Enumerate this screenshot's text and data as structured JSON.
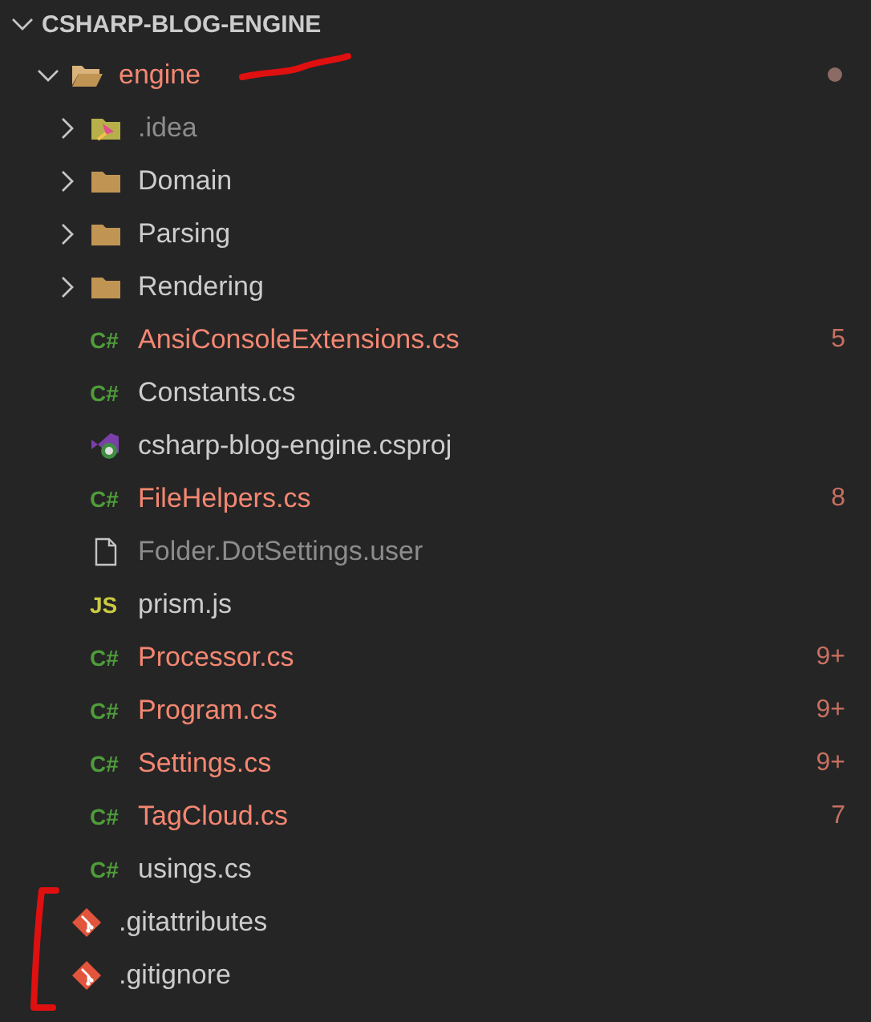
{
  "explorer": {
    "title": "CSHARP-BLOG-ENGINE",
    "expanded": true,
    "items": [
      {
        "name": "engine",
        "kind": "folder",
        "expanded": true,
        "has_errors": true,
        "dimmed": false,
        "dot": true,
        "children": [
          {
            "name": ".idea",
            "kind": "ide",
            "expanded": false,
            "has_errors": false,
            "dimmed": true
          },
          {
            "name": "Domain",
            "kind": "folder",
            "expanded": false,
            "has_errors": false,
            "dimmed": false
          },
          {
            "name": "Parsing",
            "kind": "folder",
            "expanded": false,
            "has_errors": false,
            "dimmed": false
          },
          {
            "name": "Rendering",
            "kind": "folder",
            "expanded": false,
            "has_errors": false,
            "dimmed": false
          },
          {
            "name": "AnsiConsoleExtensions.cs",
            "kind": "csharp",
            "icon_text": "C#",
            "has_errors": true,
            "dimmed": false,
            "problems": "5"
          },
          {
            "name": "Constants.cs",
            "kind": "csharp",
            "icon_text": "C#",
            "has_errors": false,
            "dimmed": false
          },
          {
            "name": "csharp-blog-engine.csproj",
            "kind": "project",
            "has_errors": false,
            "dimmed": false
          },
          {
            "name": "FileHelpers.cs",
            "kind": "csharp",
            "icon_text": "C#",
            "has_errors": true,
            "dimmed": false,
            "problems": "8"
          },
          {
            "name": "Folder.DotSettings.user",
            "kind": "plain",
            "has_errors": false,
            "dimmed": true
          },
          {
            "name": "prism.js",
            "kind": "script",
            "icon_text": "JS",
            "has_errors": false,
            "dimmed": false
          },
          {
            "name": "Processor.cs",
            "kind": "csharp",
            "icon_text": "C#",
            "has_errors": true,
            "dimmed": false,
            "problems": "9+"
          },
          {
            "name": "Program.cs",
            "kind": "csharp",
            "icon_text": "C#",
            "has_errors": true,
            "dimmed": false,
            "problems": "9+"
          },
          {
            "name": "Settings.cs",
            "kind": "csharp",
            "icon_text": "C#",
            "has_errors": true,
            "dimmed": false,
            "problems": "9+"
          },
          {
            "name": "TagCloud.cs",
            "kind": "csharp",
            "icon_text": "C#",
            "has_errors": true,
            "dimmed": false,
            "problems": "7"
          },
          {
            "name": "usings.cs",
            "kind": "csharp",
            "icon_text": "C#",
            "has_errors": false,
            "dimmed": false
          }
        ]
      },
      {
        "name": ".gitattributes",
        "kind": "git",
        "has_errors": false,
        "dimmed": false
      },
      {
        "name": ".gitignore",
        "kind": "git",
        "has_errors": false,
        "dimmed": false
      }
    ]
  },
  "annotations": {
    "underline": true,
    "bracket": true
  }
}
